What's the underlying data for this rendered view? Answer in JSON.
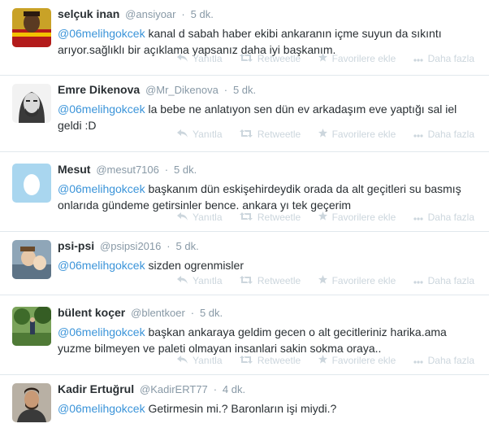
{
  "colors": {
    "mention": "#3b94d9",
    "meta": "#8899a6",
    "action": "#ccd6dd",
    "divider": "#e1e8ed"
  },
  "actions": {
    "reply": "Yanıtla",
    "retweet": "Retweetle",
    "favorite": "Favorilere ekle",
    "more": "Daha fazla"
  },
  "tweets": [
    {
      "fullname": "selçuk inan",
      "username": "@ansiyoar",
      "time": "5 dk.",
      "mention": "@06melihgokcek",
      "text": " kanal d sabah haber ekibi ankaranın içme suyun da sıkıntı arıyor.sağlıklı bir açıklama yapsanız daha iyi başkanım.",
      "avatar_icon": "avatar-icon"
    },
    {
      "fullname": "Emre Dikenova",
      "username": "@Mr_Dikenova",
      "time": "5 dk.",
      "mention": "@06melihgokcek",
      "text": " la bebe ne anlatıyon sen dün ev arkadaşım eve yaptığı sal iel geldi :D",
      "avatar_icon": "avatar-icon"
    },
    {
      "fullname": "Mesut",
      "username": "@mesut7106",
      "time": "5 dk.",
      "mention": "@06melihgokcek",
      "text": " başkanım dün eskişehirdeydik orada da alt geçitleri su basmış onlarıda gündeme getirsinler bence. ankara yı tek geçerim",
      "avatar_icon": "default-egg-avatar-icon"
    },
    {
      "fullname": "psi-psi",
      "username": "@psipsi2016",
      "time": "5 dk.",
      "mention": "@06melihgokcek",
      "text": " sizden ogrenmisler",
      "avatar_icon": "avatar-icon"
    },
    {
      "fullname": "bülent koçer",
      "username": "@blentkoer",
      "time": "5 dk.",
      "mention": "@06melihgokcek",
      "text": " başkan ankaraya geldim gecen o alt gecitleriniz harika.ama yuzme bilmeyen ve paleti olmayan insanlari sakin sokma oraya..",
      "avatar_icon": "avatar-icon"
    },
    {
      "fullname": "Kadir Ertuğrul",
      "username": "@KadirERT77",
      "time": "4 dk.",
      "mention": "@06melihgokcek",
      "text": " Getirmesin mi.? Baronların işi miydi.?",
      "avatar_icon": "avatar-icon"
    }
  ]
}
